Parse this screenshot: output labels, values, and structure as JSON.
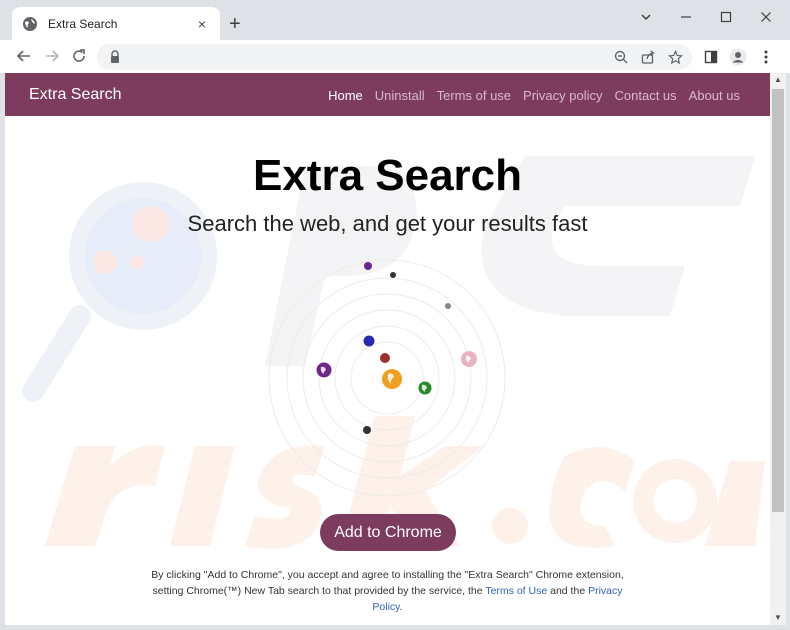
{
  "browser": {
    "tab_title": "Extra Search",
    "tab_close": "×",
    "new_tab": "+",
    "url": ""
  },
  "site": {
    "brand": "Extra Search",
    "nav": [
      "Home",
      "Uninstall",
      "Terms of use",
      "Privacy policy",
      "Contact us",
      "About us"
    ],
    "active_nav": "Home",
    "accent_color": "#7d3c5e"
  },
  "hero": {
    "title": "Extra Search",
    "subtitle": "Search the web, and get your results fast",
    "cta_label": "Add to Chrome"
  },
  "disclaimer": {
    "part1": "By clicking \"Add to Chrome\", you accept and agree to installing the \"Extra Search\" Chrome extension, setting Chrome(™) New Tab search to that provided by the service, the ",
    "terms_link": "Terms of Use",
    "part2": " and the ",
    "privacy_link": "Privacy Policy",
    "part3": "."
  },
  "icons": {
    "tab_favicon": "globe-icon",
    "back": "back-arrow-icon",
    "forward": "forward-arrow-icon",
    "reload": "reload-icon",
    "lock": "lock-icon",
    "zoom": "zoom-icon",
    "share": "share-icon",
    "bookmark": "star-icon",
    "side_panel": "side-panel-icon",
    "profile": "profile-icon",
    "menu": "kebab-menu-icon"
  }
}
